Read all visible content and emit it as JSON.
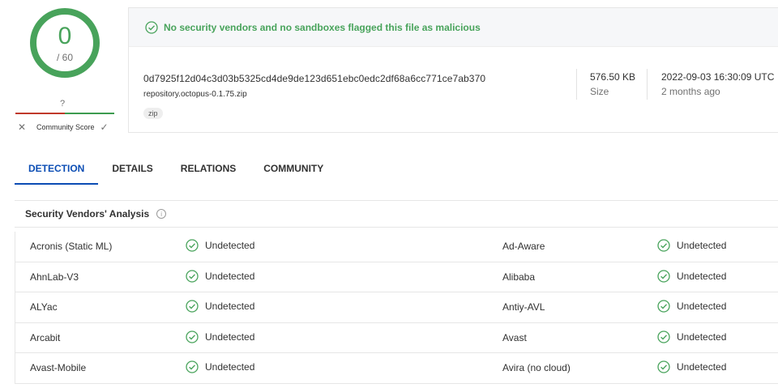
{
  "score": {
    "detections": "0",
    "total": "/ 60",
    "community_unknown": "?",
    "community_label": "Community Score",
    "vote_down_icon": "x-icon",
    "vote_up_icon": "check-icon"
  },
  "banner": {
    "text": "No security vendors and no sandboxes flagged this file as malicious",
    "color": "#48a35b"
  },
  "file": {
    "hash": "0d7925f12d04c3d03b5325cd4de9de123d651ebc0edc2df68a6cc771ce7ab370",
    "name": "repository.octopus-0.1.75.zip",
    "tag": "zip",
    "size_value": "576.50 KB",
    "size_label": "Size",
    "date_value": "2022-09-03 16:30:09 UTC",
    "date_label": "2 months ago"
  },
  "tabs": [
    {
      "label": "DETECTION",
      "active": true
    },
    {
      "label": "DETAILS",
      "active": false
    },
    {
      "label": "RELATIONS",
      "active": false
    },
    {
      "label": "COMMUNITY",
      "active": false
    }
  ],
  "section": {
    "title": "Security Vendors' Analysis",
    "info_icon": "i"
  },
  "vendors": [
    {
      "left": "Acronis (Static ML)",
      "left_status": "Undetected",
      "right": "Ad-Aware",
      "right_status": "Undetected"
    },
    {
      "left": "AhnLab-V3",
      "left_status": "Undetected",
      "right": "Alibaba",
      "right_status": "Undetected"
    },
    {
      "left": "ALYac",
      "left_status": "Undetected",
      "right": "Antiy-AVL",
      "right_status": "Undetected"
    },
    {
      "left": "Arcabit",
      "left_status": "Undetected",
      "right": "Avast",
      "right_status": "Undetected"
    },
    {
      "left": "Avast-Mobile",
      "left_status": "Undetected",
      "right": "Avira (no cloud)",
      "right_status": "Undetected"
    }
  ],
  "colors": {
    "accent": "#0b4db4",
    "clean": "#48a35b"
  }
}
